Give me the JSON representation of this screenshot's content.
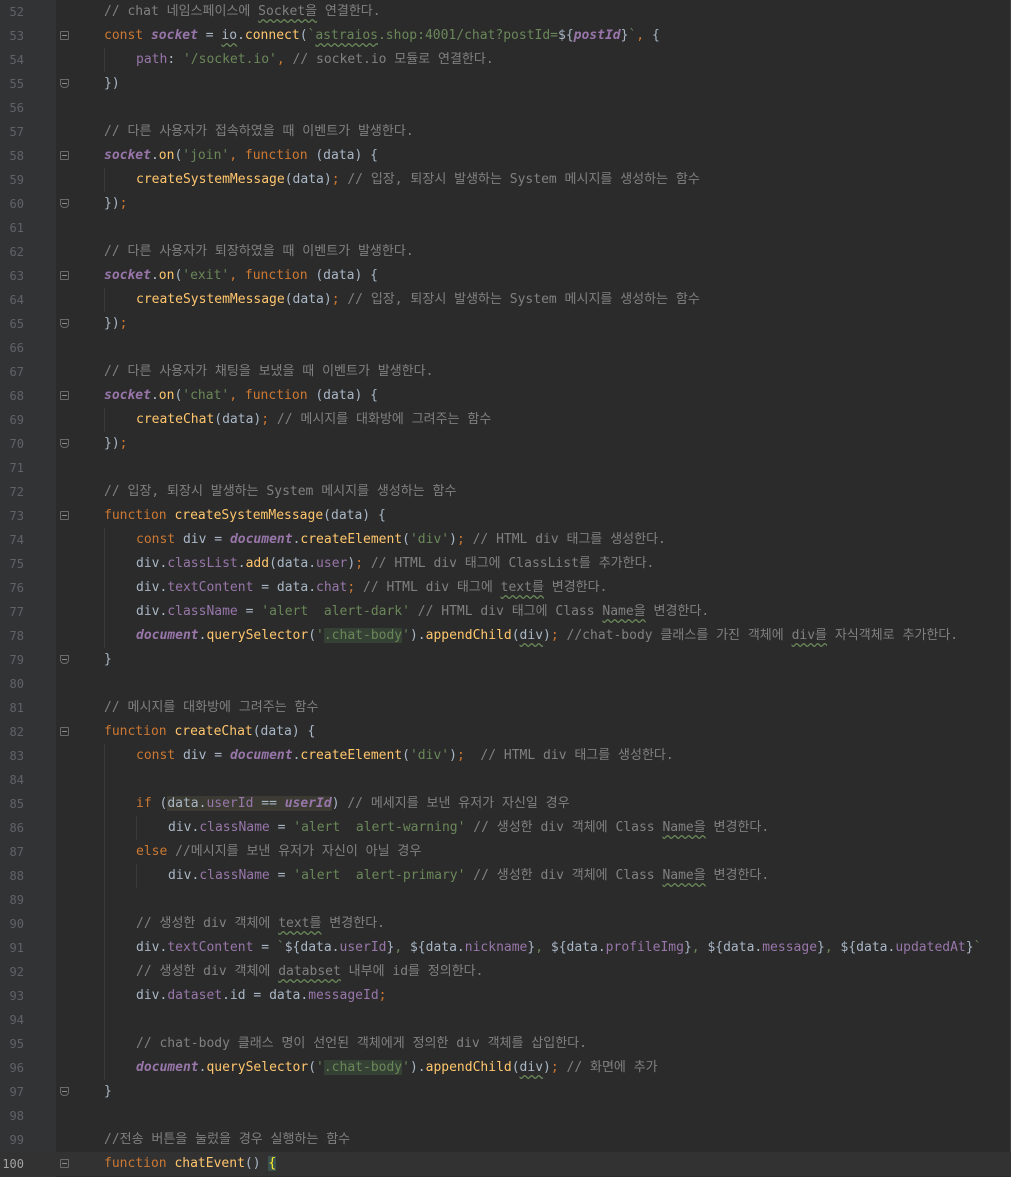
{
  "editor": {
    "language": "javascript",
    "current_line": 100,
    "lines": [
      {
        "n": "52",
        "fold": "",
        "indent": 0,
        "tokens": [
          [
            "c",
            "// chat 네임스페이스에 "
          ],
          [
            "cu",
            "Socket을"
          ],
          [
            "c",
            " 연결한다."
          ]
        ]
      },
      {
        "n": "53",
        "fold": "start",
        "indent": 0,
        "tokens": [
          [
            "k",
            "const "
          ],
          [
            "gv",
            "socket"
          ],
          [
            "t",
            " = "
          ],
          [
            "tu",
            "io"
          ],
          [
            "t",
            "."
          ],
          [
            "f",
            "connect"
          ],
          [
            "t",
            "("
          ],
          [
            "s",
            "`"
          ],
          [
            "su",
            "astraios"
          ],
          [
            "s",
            ".shop:4001/chat?postId="
          ],
          [
            "t",
            "${"
          ],
          [
            "gv",
            "postId"
          ],
          [
            "t",
            "}"
          ],
          [
            "s",
            "`"
          ],
          [
            "k",
            ", "
          ],
          [
            "t",
            "{"
          ]
        ]
      },
      {
        "n": "54",
        "fold": "",
        "indent": 1,
        "tokens": [
          [
            "p",
            "path"
          ],
          [
            "t",
            ": "
          ],
          [
            "s",
            "'/socket.io'"
          ],
          [
            "k",
            ", "
          ],
          [
            "c",
            "// socket.io 모듈로 연결한다."
          ]
        ]
      },
      {
        "n": "55",
        "fold": "end",
        "indent": 0,
        "tokens": [
          [
            "t",
            "})"
          ]
        ]
      },
      {
        "n": "56",
        "fold": "",
        "indent": 0,
        "tokens": []
      },
      {
        "n": "57",
        "fold": "",
        "indent": 0,
        "tokens": [
          [
            "c",
            "// 다른 사용자가 접속하였을 때 이벤트가 발생한다."
          ]
        ]
      },
      {
        "n": "58",
        "fold": "start",
        "indent": 0,
        "tokens": [
          [
            "gv",
            "socket"
          ],
          [
            "t",
            "."
          ],
          [
            "f",
            "on"
          ],
          [
            "t",
            "("
          ],
          [
            "s",
            "'join'"
          ],
          [
            "k",
            ", function "
          ],
          [
            "t",
            "(data) {"
          ]
        ]
      },
      {
        "n": "59",
        "fold": "",
        "indent": 1,
        "tokens": [
          [
            "f",
            "createSystemMessage"
          ],
          [
            "t",
            "(data)"
          ],
          [
            "k",
            "; "
          ],
          [
            "c",
            "// 입장, 퇴장시 발생하는 System 메시지를 생성하는 함수"
          ]
        ]
      },
      {
        "n": "60",
        "fold": "end",
        "indent": 0,
        "tokens": [
          [
            "t",
            "})"
          ],
          [
            "k",
            ";"
          ]
        ]
      },
      {
        "n": "61",
        "fold": "",
        "indent": 0,
        "tokens": []
      },
      {
        "n": "62",
        "fold": "",
        "indent": 0,
        "tokens": [
          [
            "c",
            "// 다른 사용자가 퇴장하였을 때 이벤트가 발생한다."
          ]
        ]
      },
      {
        "n": "63",
        "fold": "start",
        "indent": 0,
        "tokens": [
          [
            "gv",
            "socket"
          ],
          [
            "t",
            "."
          ],
          [
            "f",
            "on"
          ],
          [
            "t",
            "("
          ],
          [
            "s",
            "'exit'"
          ],
          [
            "k",
            ", function "
          ],
          [
            "t",
            "(data) {"
          ]
        ]
      },
      {
        "n": "64",
        "fold": "",
        "indent": 1,
        "tokens": [
          [
            "f",
            "createSystemMessage"
          ],
          [
            "t",
            "(data)"
          ],
          [
            "k",
            "; "
          ],
          [
            "c",
            "// 입장, 퇴장시 발생하는 System 메시지를 생성하는 함수"
          ]
        ]
      },
      {
        "n": "65",
        "fold": "end",
        "indent": 0,
        "tokens": [
          [
            "t",
            "})"
          ],
          [
            "k",
            ";"
          ]
        ]
      },
      {
        "n": "66",
        "fold": "",
        "indent": 0,
        "tokens": []
      },
      {
        "n": "67",
        "fold": "",
        "indent": 0,
        "tokens": [
          [
            "c",
            "// 다른 사용자가 채팅을 보냈을 때 이벤트가 발생한다."
          ]
        ]
      },
      {
        "n": "68",
        "fold": "start",
        "indent": 0,
        "tokens": [
          [
            "gv",
            "socket"
          ],
          [
            "t",
            "."
          ],
          [
            "f",
            "on"
          ],
          [
            "t",
            "("
          ],
          [
            "s",
            "'chat'"
          ],
          [
            "k",
            ", function "
          ],
          [
            "t",
            "(data) {"
          ]
        ]
      },
      {
        "n": "69",
        "fold": "",
        "indent": 1,
        "tokens": [
          [
            "f",
            "createChat"
          ],
          [
            "t",
            "(data)"
          ],
          [
            "k",
            "; "
          ],
          [
            "c",
            "// 메시지를 대화방에 그려주는 함수"
          ]
        ]
      },
      {
        "n": "70",
        "fold": "end",
        "indent": 0,
        "tokens": [
          [
            "t",
            "})"
          ],
          [
            "k",
            ";"
          ]
        ]
      },
      {
        "n": "71",
        "fold": "",
        "indent": 0,
        "tokens": []
      },
      {
        "n": "72",
        "fold": "",
        "indent": 0,
        "tokens": [
          [
            "c",
            "// 입장, 퇴장시 발생하는 System 메시지를 생성하는 함수"
          ]
        ]
      },
      {
        "n": "73",
        "fold": "start",
        "indent": 0,
        "tokens": [
          [
            "k",
            "function "
          ],
          [
            "f",
            "createSystemMessage"
          ],
          [
            "t",
            "(data) {"
          ]
        ]
      },
      {
        "n": "74",
        "fold": "",
        "indent": 1,
        "tokens": [
          [
            "k",
            "const "
          ],
          [
            "t",
            "div = "
          ],
          [
            "gv",
            "document"
          ],
          [
            "t",
            "."
          ],
          [
            "f",
            "createElement"
          ],
          [
            "t",
            "("
          ],
          [
            "s",
            "'div'"
          ],
          [
            "t",
            ")"
          ],
          [
            "k",
            "; "
          ],
          [
            "c",
            "// HTML div 태그를 생성한다."
          ]
        ]
      },
      {
        "n": "75",
        "fold": "",
        "indent": 1,
        "tokens": [
          [
            "t",
            "div."
          ],
          [
            "p",
            "classList"
          ],
          [
            "t",
            "."
          ],
          [
            "f",
            "add"
          ],
          [
            "t",
            "(data."
          ],
          [
            "p",
            "user"
          ],
          [
            "t",
            ")"
          ],
          [
            "k",
            "; "
          ],
          [
            "c",
            "// HTML div 태그에 ClassList를 추가한다."
          ]
        ]
      },
      {
        "n": "76",
        "fold": "",
        "indent": 1,
        "tokens": [
          [
            "t",
            "div."
          ],
          [
            "p",
            "textContent"
          ],
          [
            "t",
            " = data."
          ],
          [
            "p",
            "chat"
          ],
          [
            "k",
            "; "
          ],
          [
            "c",
            "// HTML div 태그에 "
          ],
          [
            "cu",
            "text를"
          ],
          [
            "c",
            " 변경한다."
          ]
        ]
      },
      {
        "n": "77",
        "fold": "",
        "indent": 1,
        "tokens": [
          [
            "t",
            "div."
          ],
          [
            "p",
            "className"
          ],
          [
            "t",
            " = "
          ],
          [
            "s",
            "'alert  alert-dark'"
          ],
          [
            "t",
            " "
          ],
          [
            "c",
            "// HTML div 태그에 Class "
          ],
          [
            "cu",
            "Name을"
          ],
          [
            "c",
            " 변경한다."
          ]
        ]
      },
      {
        "n": "78",
        "fold": "",
        "indent": 1,
        "tokens": [
          [
            "gv",
            "document"
          ],
          [
            "t",
            "."
          ],
          [
            "f",
            "querySelector"
          ],
          [
            "t",
            "("
          ],
          [
            "s",
            "'"
          ],
          [
            "sh",
            ".chat-body"
          ],
          [
            "s",
            "'"
          ],
          [
            "t",
            ")."
          ],
          [
            "f",
            "appendChild"
          ],
          [
            "t",
            "("
          ],
          [
            "tu",
            "div"
          ],
          [
            "t",
            ")"
          ],
          [
            "k",
            "; "
          ],
          [
            "c",
            "//chat-body 클래스를 가진 객체에 "
          ],
          [
            "cu",
            "div를"
          ],
          [
            "c",
            " 자식객체로 추가한다."
          ]
        ]
      },
      {
        "n": "79",
        "fold": "end",
        "indent": 0,
        "tokens": [
          [
            "t",
            "}"
          ]
        ]
      },
      {
        "n": "80",
        "fold": "",
        "indent": 0,
        "tokens": []
      },
      {
        "n": "81",
        "fold": "",
        "indent": 0,
        "tokens": [
          [
            "c",
            "// 메시지를 대화방에 그려주는 함수"
          ]
        ]
      },
      {
        "n": "82",
        "fold": "start",
        "indent": 0,
        "tokens": [
          [
            "k",
            "function "
          ],
          [
            "f",
            "createChat"
          ],
          [
            "t",
            "(data) {"
          ]
        ]
      },
      {
        "n": "83",
        "fold": "",
        "indent": 1,
        "tokens": [
          [
            "k",
            "const "
          ],
          [
            "t",
            "div = "
          ],
          [
            "gv",
            "document"
          ],
          [
            "t",
            "."
          ],
          [
            "f",
            "createElement"
          ],
          [
            "t",
            "("
          ],
          [
            "s",
            "'div'"
          ],
          [
            "t",
            ")"
          ],
          [
            "k",
            ";  "
          ],
          [
            "c",
            "// HTML div 태그를 생성한다."
          ]
        ]
      },
      {
        "n": "84",
        "fold": "",
        "indent": 1,
        "tokens": []
      },
      {
        "n": "85",
        "fold": "",
        "indent": 1,
        "tokens": [
          [
            "k",
            "if "
          ],
          [
            "t",
            "("
          ],
          [
            "th",
            "data."
          ],
          [
            "ph",
            "userId"
          ],
          [
            "th",
            " == "
          ],
          [
            "gvh",
            "userId"
          ],
          [
            "t",
            ") "
          ],
          [
            "c",
            "// 메세지를 보낸 유저가 자신일 경우"
          ]
        ]
      },
      {
        "n": "86",
        "fold": "",
        "indent": 2,
        "tokens": [
          [
            "t",
            "div."
          ],
          [
            "p",
            "className"
          ],
          [
            "t",
            " = "
          ],
          [
            "s",
            "'alert  alert-warning'"
          ],
          [
            "t",
            " "
          ],
          [
            "c",
            "// 생성한 div 객체에 Class "
          ],
          [
            "cu",
            "Name을"
          ],
          [
            "c",
            " 변경한다."
          ]
        ]
      },
      {
        "n": "87",
        "fold": "",
        "indent": 1,
        "tokens": [
          [
            "k",
            "else "
          ],
          [
            "c",
            "//메시지를 보낸 유저가 자신이 아닐 경우"
          ]
        ]
      },
      {
        "n": "88",
        "fold": "",
        "indent": 2,
        "tokens": [
          [
            "t",
            "div."
          ],
          [
            "p",
            "className"
          ],
          [
            "t",
            " = "
          ],
          [
            "s",
            "'alert  alert-primary'"
          ],
          [
            "t",
            " "
          ],
          [
            "c",
            "// 생성한 div 객체에 Class "
          ],
          [
            "cu",
            "Name을"
          ],
          [
            "c",
            " 변경한다."
          ]
        ]
      },
      {
        "n": "89",
        "fold": "",
        "indent": 1,
        "tokens": []
      },
      {
        "n": "90",
        "fold": "",
        "indent": 1,
        "tokens": [
          [
            "c",
            "// 생성한 div 객체에 "
          ],
          [
            "cu",
            "text를"
          ],
          [
            "c",
            " 변경한다."
          ]
        ]
      },
      {
        "n": "91",
        "fold": "",
        "indent": 1,
        "tokens": [
          [
            "t",
            "div."
          ],
          [
            "p",
            "textContent"
          ],
          [
            "t",
            " = "
          ],
          [
            "s",
            "`"
          ],
          [
            "t",
            "${data."
          ],
          [
            "p",
            "userId"
          ],
          [
            "t",
            "}"
          ],
          [
            "s",
            ", "
          ],
          [
            "t",
            "${data."
          ],
          [
            "p",
            "nickname"
          ],
          [
            "t",
            "}"
          ],
          [
            "s",
            ", "
          ],
          [
            "t",
            "${data."
          ],
          [
            "p",
            "profileImg"
          ],
          [
            "t",
            "}"
          ],
          [
            "s",
            ", "
          ],
          [
            "t",
            "${data."
          ],
          [
            "p",
            "message"
          ],
          [
            "t",
            "}"
          ],
          [
            "s",
            ", "
          ],
          [
            "t",
            "${data."
          ],
          [
            "p",
            "updatedAt"
          ],
          [
            "t",
            "}"
          ],
          [
            "s",
            "`"
          ]
        ]
      },
      {
        "n": "92",
        "fold": "",
        "indent": 1,
        "tokens": [
          [
            "c",
            "// 생성한 div 객체에 "
          ],
          [
            "cu",
            "databset"
          ],
          [
            "c",
            " 내부에 id를 정의한다."
          ]
        ]
      },
      {
        "n": "93",
        "fold": "",
        "indent": 1,
        "tokens": [
          [
            "t",
            "div."
          ],
          [
            "p",
            "dataset"
          ],
          [
            "t",
            ".id = data."
          ],
          [
            "p",
            "messageId"
          ],
          [
            "k",
            ";"
          ]
        ]
      },
      {
        "n": "94",
        "fold": "",
        "indent": 1,
        "tokens": []
      },
      {
        "n": "95",
        "fold": "",
        "indent": 1,
        "tokens": [
          [
            "c",
            "// chat-body 클래스 명이 선언된 객체에게 정의한 div 객체를 삽입한다."
          ]
        ]
      },
      {
        "n": "96",
        "fold": "",
        "indent": 1,
        "tokens": [
          [
            "gv",
            "document"
          ],
          [
            "t",
            "."
          ],
          [
            "f",
            "querySelector"
          ],
          [
            "t",
            "("
          ],
          [
            "s",
            "'"
          ],
          [
            "sh",
            ".chat-body"
          ],
          [
            "s",
            "'"
          ],
          [
            "t",
            ")."
          ],
          [
            "f",
            "appendChild"
          ],
          [
            "t",
            "("
          ],
          [
            "tu",
            "div"
          ],
          [
            "t",
            ")"
          ],
          [
            "k",
            "; "
          ],
          [
            "c",
            "// 화면에 추가"
          ]
        ]
      },
      {
        "n": "97",
        "fold": "end",
        "indent": 0,
        "tokens": [
          [
            "t",
            "}"
          ]
        ]
      },
      {
        "n": "98",
        "fold": "",
        "indent": 0,
        "tokens": []
      },
      {
        "n": "99",
        "fold": "",
        "indent": 0,
        "tokens": [
          [
            "c",
            "//전송 버튼을 눌렀을 경우 실행하는 함수"
          ]
        ]
      },
      {
        "n": "100",
        "fold": "start",
        "indent": 0,
        "tokens": [
          [
            "k",
            "function "
          ],
          [
            "f",
            "chatEvent"
          ],
          [
            "t",
            "() "
          ],
          [
            "br",
            "{"
          ]
        ]
      }
    ]
  }
}
